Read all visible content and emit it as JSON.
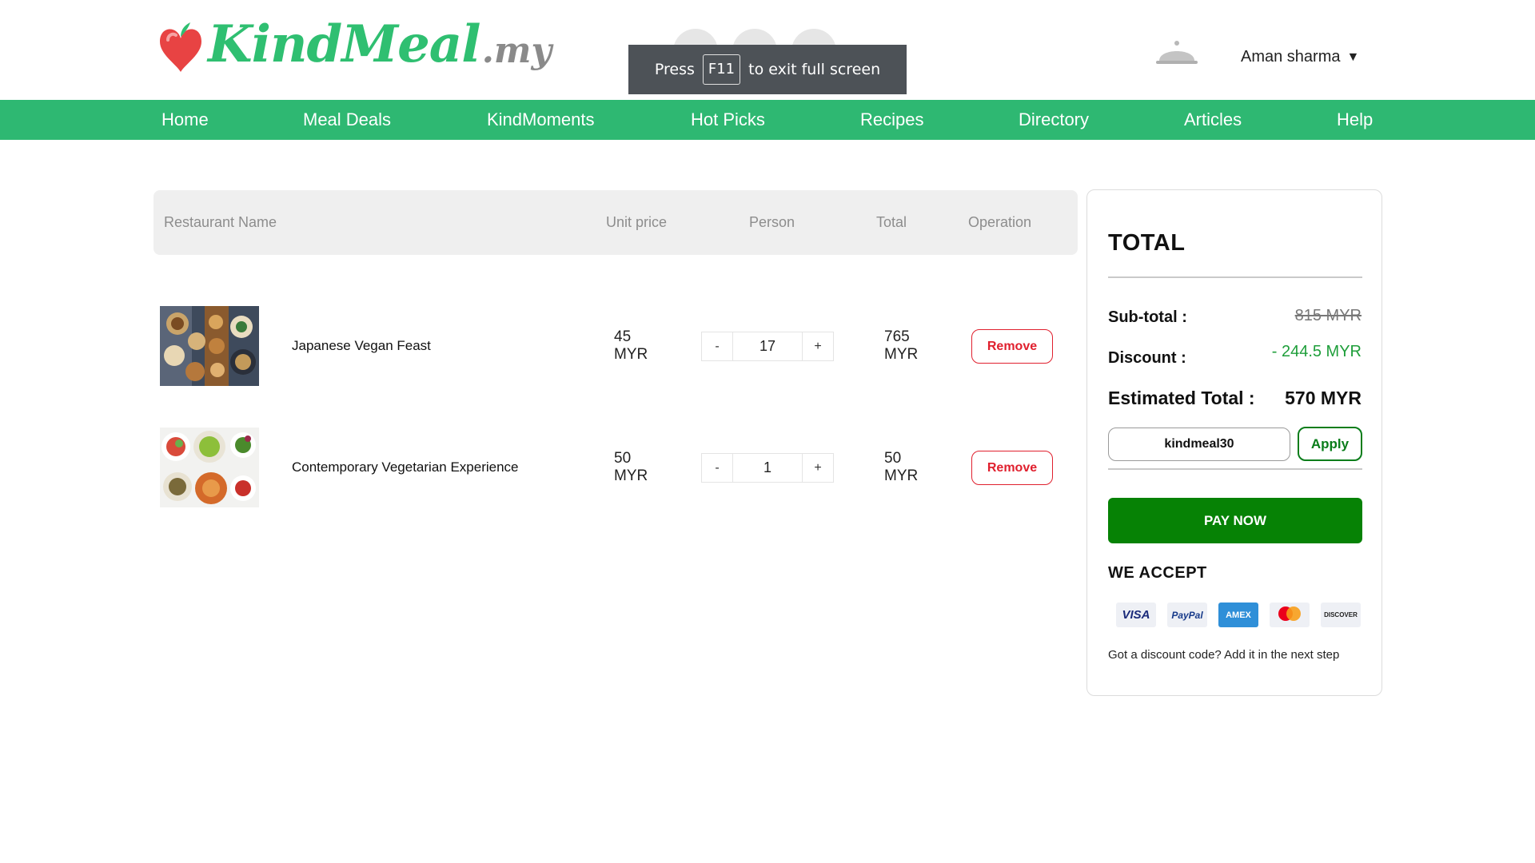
{
  "brand": {
    "logo_name": "KindMeal",
    "logo_tld": ".my"
  },
  "overlay": {
    "press": "Press",
    "key": "F11",
    "message": "to exit full screen"
  },
  "user": {
    "name": "Aman sharma",
    "caret": "▼"
  },
  "nav": [
    "Home",
    "Meal Deals",
    "KindMoments",
    "Hot Picks",
    "Recipes",
    "Directory",
    "Articles",
    "Help"
  ],
  "cart": {
    "headers": {
      "restaurant": "Restaurant Name",
      "unit_price": "Unit price",
      "person": "Person",
      "total": "Total",
      "operation": "Operation"
    },
    "items": [
      {
        "name": "Japanese Vegan Feast",
        "price_amount": "45",
        "price_currency": "MYR",
        "qty": "17",
        "total_amount": "765",
        "total_currency": "MYR",
        "minus": "-",
        "plus": "+",
        "remove": "Remove"
      },
      {
        "name": "Contemporary Vegetarian Experience",
        "price_amount": "50",
        "price_currency": "MYR",
        "qty": "1",
        "total_amount": "50",
        "total_currency": "MYR",
        "minus": "-",
        "plus": "+",
        "remove": "Remove"
      }
    ]
  },
  "summary": {
    "title": "TOTAL",
    "subtotal_label": "Sub-total :",
    "subtotal_value": "815 MYR",
    "discount_label": "Discount :",
    "discount_value": "- 244.5 MYR",
    "estimated_label": "Estimated Total :",
    "estimated_value": "570 MYR",
    "coupon_value": "kindmeal30",
    "apply": "Apply",
    "pay": "PAY NOW",
    "accept_title": "WE ACCEPT",
    "cards": {
      "visa": "VISA",
      "paypal": "PayPal",
      "amex": "AMEX",
      "discover": "DISCOVER"
    },
    "note": "Got a discount code? Add it in the next step"
  },
  "colors": {
    "brand_green": "#2eb872",
    "pay_green": "#068205",
    "remove_red": "#e0202e",
    "discount_green": "#1e9e3a"
  }
}
